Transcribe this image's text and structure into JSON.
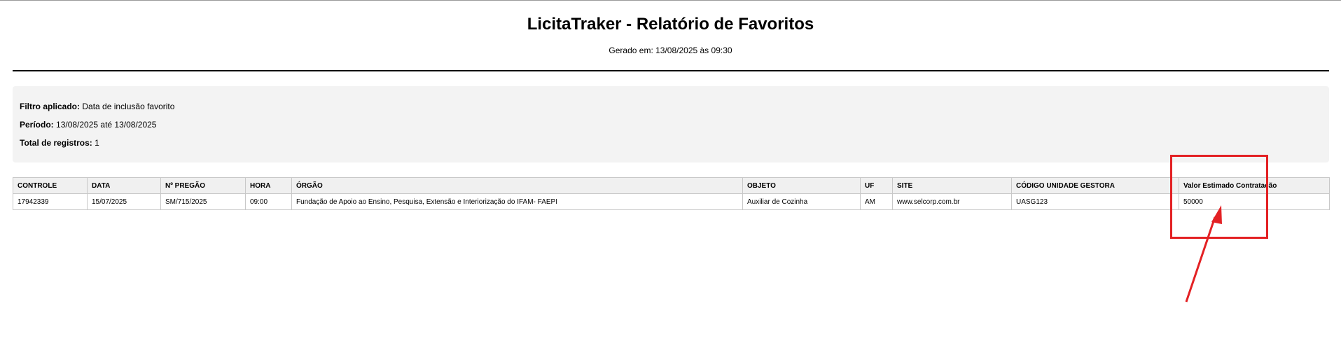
{
  "report": {
    "title": "LicitaTraker - Relatório de Favoritos",
    "generated": "Gerado em: 13/08/2025 às 09:30"
  },
  "filters": {
    "filter_label": "Filtro aplicado:",
    "filter_value": "Data de inclusão favorito",
    "period_label": "Período:",
    "period_value": "13/08/2025 até 13/08/2025",
    "total_label": "Total de registros:",
    "total_value": "1"
  },
  "table": {
    "headers": [
      "CONTROLE",
      "DATA",
      "Nº PREGÃO",
      "HORA",
      "ÓRGÃO",
      "OBJETO",
      "UF",
      "SITE",
      "CÓDIGO UNIDADE GESTORA",
      "Valor Estimado Contratação"
    ],
    "rows": [
      [
        "17942339",
        "15/07/2025",
        "SM/715/2025",
        "09:00",
        "Fundação de Apoio ao Ensino, Pesquisa, Extensão e Interiorização do IFAM- FAEPI",
        "Auxiliar de Cozinha",
        "AM",
        "www.selcorp.com.br",
        "UASG123",
        "50000"
      ]
    ]
  },
  "annotation": {
    "color": "#e32124"
  }
}
